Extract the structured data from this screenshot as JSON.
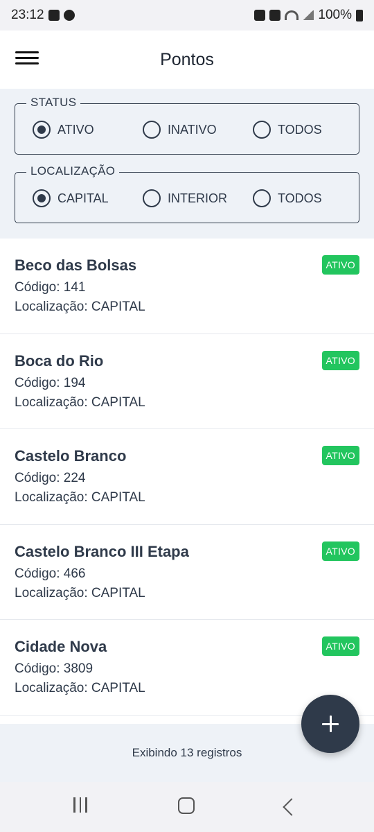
{
  "status_bar": {
    "time": "23:12",
    "battery": "100%",
    "left_icons": [
      "image-icon",
      "spotify-icon"
    ],
    "right_icons": [
      "alarm-icon",
      "mute-icon",
      "wifi-icon",
      "signal-icon",
      "battery-icon"
    ]
  },
  "app_bar": {
    "title": "Pontos",
    "menu_icon": "hamburger-menu-icon"
  },
  "filters": {
    "status": {
      "legend": "STATUS",
      "options": [
        {
          "label": "ATIVO",
          "selected": true
        },
        {
          "label": "INATIVO",
          "selected": false
        },
        {
          "label": "TODOS",
          "selected": false
        }
      ]
    },
    "location": {
      "legend": "LOCALIZAÇÃO",
      "options": [
        {
          "label": "CAPITAL",
          "selected": true
        },
        {
          "label": "INTERIOR",
          "selected": false
        },
        {
          "label": "TODOS",
          "selected": false
        }
      ]
    }
  },
  "items": [
    {
      "name": "Beco das Bolsas",
      "code": "Código: 141",
      "location": "Localização: CAPITAL",
      "badge": "ATIVO"
    },
    {
      "name": "Boca do Rio",
      "code": "Código: 194",
      "location": "Localização: CAPITAL",
      "badge": "ATIVO"
    },
    {
      "name": "Castelo Branco",
      "code": "Código: 224",
      "location": "Localização: CAPITAL",
      "badge": "ATIVO"
    },
    {
      "name": "Castelo Branco III Etapa",
      "code": "Código: 466",
      "location": "Localização: CAPITAL",
      "badge": "ATIVO"
    },
    {
      "name": "Cidade Nova",
      "code": "Código: 3809",
      "location": "Localização: CAPITAL",
      "badge": "ATIVO"
    }
  ],
  "footer": {
    "count_text": "Exibindo 13 registros"
  },
  "fab": {
    "icon": "plus-icon"
  },
  "colors": {
    "primary": "#2f3a4a",
    "badge_active": "#22c55e",
    "filters_bg": "#eef2f7"
  }
}
